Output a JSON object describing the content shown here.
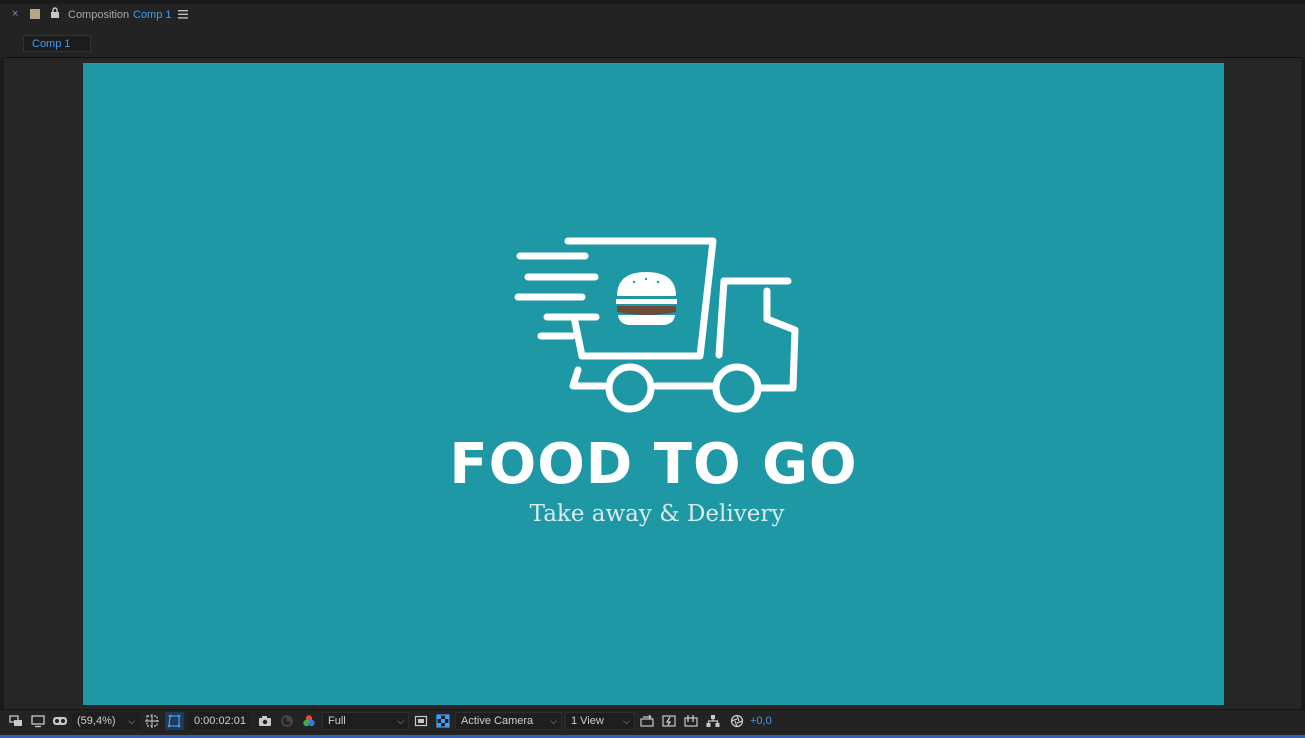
{
  "header": {
    "close_label": "×",
    "title_prefix": "Composition",
    "title_comp": "Comp 1"
  },
  "tabs": [
    {
      "label": "Comp 1"
    }
  ],
  "canvas": {
    "background_color": "#1e98a5",
    "logo_title": "FOOD TO GO",
    "logo_subtitle": "Take away & Delivery"
  },
  "toolbar": {
    "zoom_value": "(59,4%)",
    "zoom_chevron": "⌵",
    "timecode": "0:00:02:01",
    "resolution_value": "Full",
    "camera_value": "Active Camera",
    "views_value": "1 View",
    "exposure_value": "+0,0",
    "chevron": "⌵"
  },
  "colors": {
    "accent": "#3d9df2",
    "panel_bg": "#232323",
    "canvas_bg": "#1e98a5",
    "label_swatch": "#b7a58a"
  },
  "icons": [
    "close-icon",
    "label-color-swatch",
    "lock-icon",
    "panel-menu-icon",
    "always-preview-icon",
    "monitor-icon",
    "vr-goggles-icon",
    "grid-guides-icon",
    "mask-visibility-icon",
    "snapshot-camera-icon",
    "show-snapshot-icon",
    "color-channels-icon",
    "region-of-interest-icon",
    "transparency-grid-icon",
    "reset-exposure-icon",
    "fast-preview-icon",
    "timeline-icon",
    "flowchart-icon",
    "exposure-icon"
  ]
}
